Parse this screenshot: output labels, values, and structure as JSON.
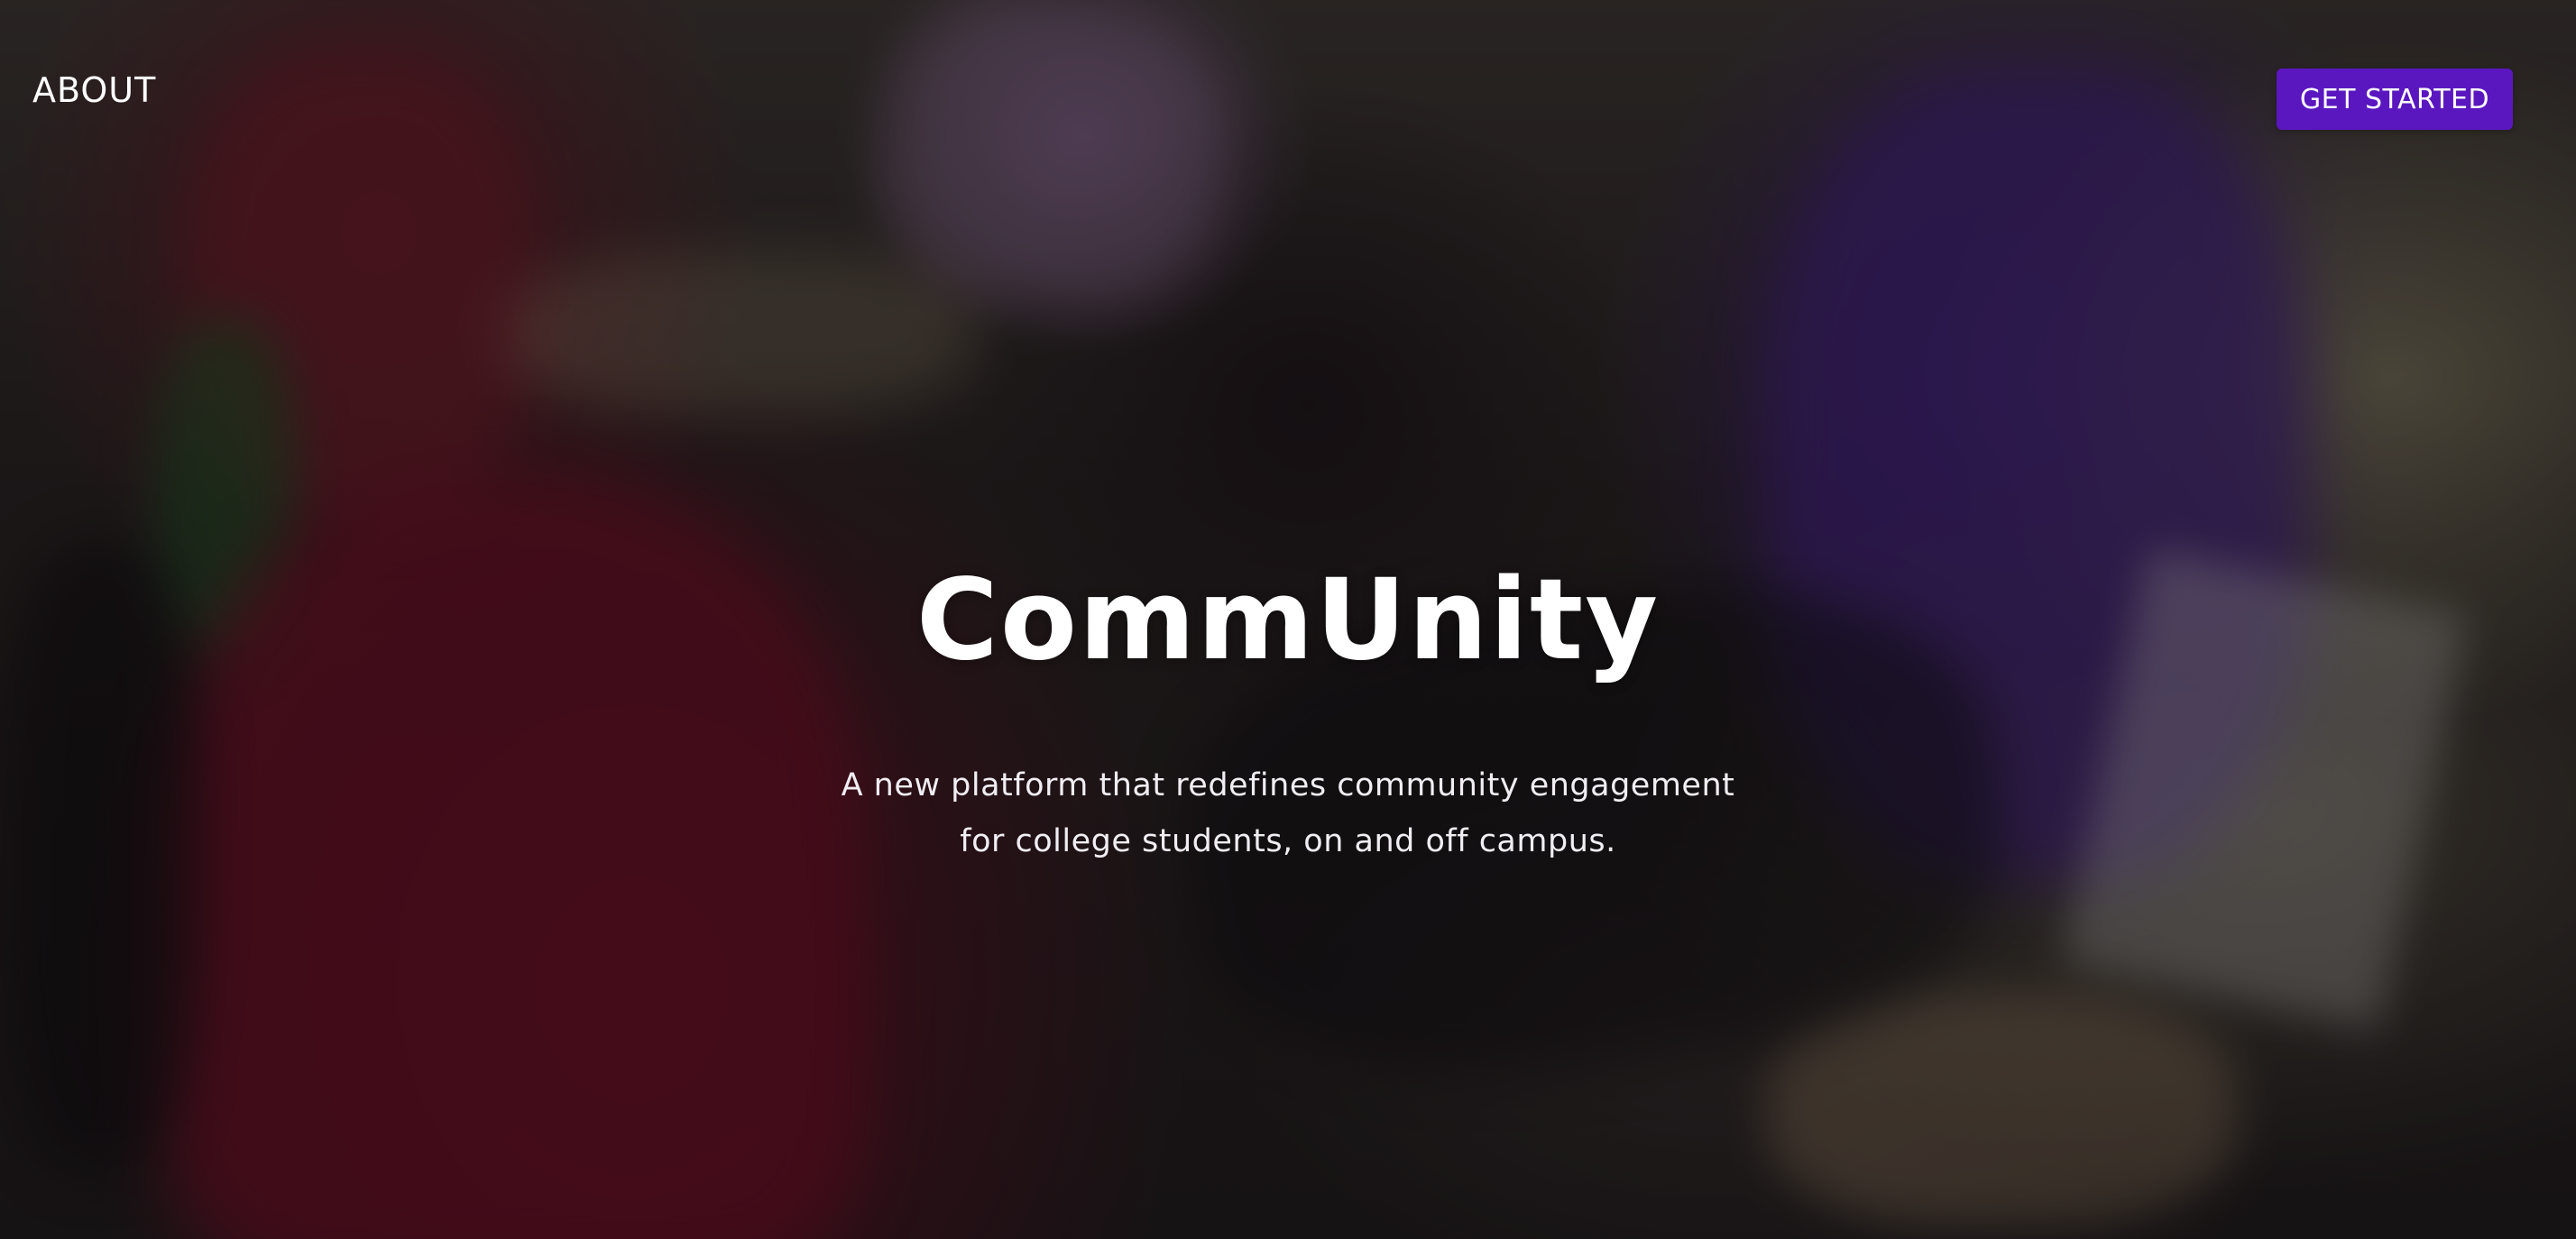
{
  "nav": {
    "about_label": "ABOUT",
    "cta_label": "GET STARTED",
    "cta_color": "#5a17bf"
  },
  "hero": {
    "title": "CommUnity",
    "subtitle_line1": "A new platform that redefines community engagement",
    "subtitle_line2": "for college students, on and off campus."
  },
  "background": {
    "image_description": null,
    "overlay_color": "#0c080e"
  }
}
